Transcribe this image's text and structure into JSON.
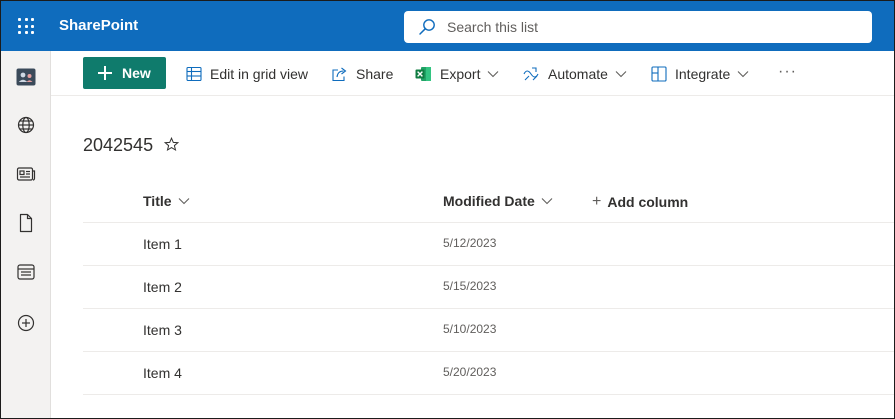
{
  "app": {
    "name": "SharePoint",
    "search_placeholder": "Search this list",
    "brand_color": "#0f6cbd"
  },
  "rail": {
    "items": [
      {
        "icon": "site-avatar-icon"
      },
      {
        "icon": "globe-icon"
      },
      {
        "icon": "news-icon"
      },
      {
        "icon": "document-icon"
      },
      {
        "icon": "list-icon"
      },
      {
        "icon": "add-circle-icon"
      }
    ]
  },
  "toolbar": {
    "new_label": "New",
    "new_color": "#0f7b6c",
    "edit_grid_label": "Edit in grid view",
    "share_label": "Share",
    "export_label": "Export",
    "automate_label": "Automate",
    "integrate_label": "Integrate",
    "more_label": "···"
  },
  "list": {
    "title": "2042545",
    "columns": {
      "title": "Title",
      "modified": "Modified Date",
      "add_column": "Add column"
    },
    "rows": [
      {
        "title": "Item 1",
        "modified": "5/12/2023"
      },
      {
        "title": "Item 2",
        "modified": "5/15/2023"
      },
      {
        "title": "Item 3",
        "modified": "5/10/2023"
      },
      {
        "title": "Item 4",
        "modified": "5/20/2023"
      }
    ]
  }
}
